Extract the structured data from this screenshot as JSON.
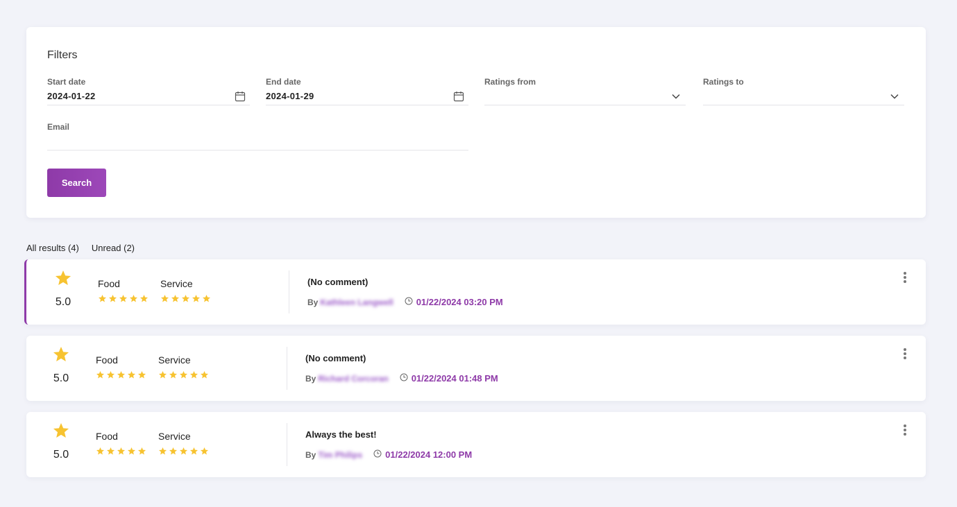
{
  "filters": {
    "title": "Filters",
    "start_date": {
      "label": "Start date",
      "value": "2024-01-22"
    },
    "end_date": {
      "label": "End date",
      "value": "2024-01-29"
    },
    "ratings_from": {
      "label": "Ratings from",
      "value": ""
    },
    "ratings_to": {
      "label": "Ratings to",
      "value": ""
    },
    "email": {
      "label": "Email",
      "value": ""
    },
    "search_label": "Search"
  },
  "tabs": [
    {
      "label": "All results (4)"
    },
    {
      "label": "Unread (2)"
    }
  ],
  "reviews": [
    {
      "unread": true,
      "overall": "5.0",
      "categories": [
        {
          "label": "Food",
          "stars": 5
        },
        {
          "label": "Service",
          "stars": 5
        }
      ],
      "comment": "(No comment)",
      "by_label": "By",
      "author": "Kathleen Langwell",
      "datetime": "01/22/2024 03:20 PM"
    },
    {
      "unread": false,
      "overall": "5.0",
      "categories": [
        {
          "label": "Food",
          "stars": 5
        },
        {
          "label": "Service",
          "stars": 5
        }
      ],
      "comment": "(No comment)",
      "by_label": "By",
      "author": "Richard Corcoran",
      "datetime": "01/22/2024 01:48 PM"
    },
    {
      "unread": false,
      "overall": "5.0",
      "categories": [
        {
          "label": "Food",
          "stars": 5
        },
        {
          "label": "Service",
          "stars": 5
        }
      ],
      "comment": "Always the best!",
      "by_label": "By",
      "author": "Tim Philips",
      "datetime": "01/22/2024 12:00 PM"
    }
  ],
  "colors": {
    "accent": "#8e3aa8",
    "star": "#f7c331",
    "background": "#f2f3f9"
  },
  "icons": {
    "date_field": "calendar-icon",
    "select_field": "chevron-down-icon",
    "rating": "star-icon",
    "time": "clock-icon",
    "menu": "more-vertical-icon"
  }
}
